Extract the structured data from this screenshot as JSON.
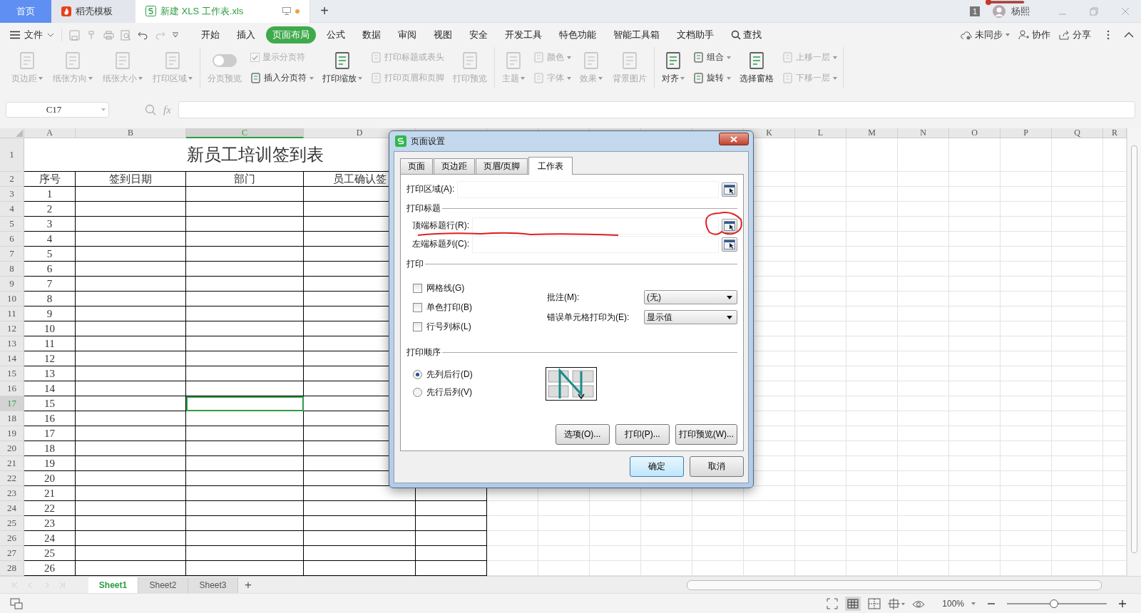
{
  "tabs": [
    {
      "label": "首页",
      "kind": "home",
      "selected": false
    },
    {
      "label": "稻壳模板",
      "kind": "docer",
      "selected": false
    },
    {
      "label": "新建 XLS 工作表.xls",
      "kind": "file",
      "selected": true
    }
  ],
  "new_tab": "+",
  "account": {
    "badge": "1",
    "name": "杨熙"
  },
  "file_menu": "文件",
  "menu": [
    {
      "label": "开始",
      "selected": false
    },
    {
      "label": "插入",
      "selected": false
    },
    {
      "label": "页面布局",
      "selected": true
    },
    {
      "label": "公式",
      "selected": false
    },
    {
      "label": "数据",
      "selected": false
    },
    {
      "label": "审阅",
      "selected": false
    },
    {
      "label": "视图",
      "selected": false
    },
    {
      "label": "安全",
      "selected": false
    },
    {
      "label": "开发工具",
      "selected": false
    },
    {
      "label": "特色功能",
      "selected": false
    },
    {
      "label": "智能工具箱",
      "selected": false
    },
    {
      "label": "文档助手",
      "selected": false
    }
  ],
  "search": "查找",
  "right_actions": [
    {
      "label": "未同步",
      "kind": "sync"
    },
    {
      "label": "协作",
      "kind": "collab"
    },
    {
      "label": "分享",
      "kind": "share"
    }
  ],
  "ribbon": [
    [
      [
        {
          "label": "页边距",
          "kind": "large",
          "disabled": true,
          "dropdown": true
        }
      ],
      [
        {
          "label": "纸张方向",
          "kind": "large",
          "disabled": true,
          "dropdown": true
        }
      ],
      [
        {
          "label": "纸张大小",
          "kind": "large",
          "disabled": true,
          "dropdown": true
        }
      ],
      [
        {
          "label": "打印区域",
          "kind": "large",
          "disabled": true,
          "dropdown": true
        }
      ]
    ],
    [
      [
        {
          "label": "分页预览",
          "kind": "toggle",
          "disabled": true,
          "dropdown": false,
          "on": false
        }
      ],
      [
        {
          "label": "显示分页符",
          "kind": "check",
          "disabled": true,
          "dropdown": false,
          "checked": true
        },
        {
          "label": "插入分页符",
          "kind": "small",
          "disabled": false,
          "dropdown": true
        }
      ],
      [
        {
          "label": "打印缩放",
          "kind": "large",
          "disabled": false,
          "dropdown": true
        }
      ],
      [
        {
          "label": "打印标题或表头",
          "kind": "small",
          "disabled": true,
          "dropdown": false
        },
        {
          "label": "打印页眉和页脚",
          "kind": "small",
          "disabled": true,
          "dropdown": false
        }
      ],
      [
        {
          "label": "打印预览",
          "kind": "large",
          "disabled": true,
          "dropdown": false
        }
      ]
    ],
    [
      [
        {
          "label": "主题",
          "kind": "large",
          "disabled": true,
          "dropdown": true
        }
      ],
      [
        {
          "label": "颜色",
          "kind": "small",
          "disabled": true,
          "dropdown": true
        },
        {
          "label": "字体",
          "kind": "small",
          "disabled": true,
          "dropdown": true
        }
      ],
      [
        {
          "label": "效果",
          "kind": "large",
          "disabled": true,
          "dropdown": true
        }
      ],
      [
        {
          "label": "背景图片",
          "kind": "large",
          "disabled": true,
          "dropdown": false
        }
      ]
    ],
    [
      [
        {
          "label": "对齐",
          "kind": "large",
          "disabled": false,
          "dropdown": true
        }
      ],
      [
        {
          "label": "组合",
          "kind": "small",
          "disabled": false,
          "dropdown": true
        },
        {
          "label": "旋转",
          "kind": "small",
          "disabled": false,
          "dropdown": true
        }
      ],
      [
        {
          "label": "选择窗格",
          "kind": "large",
          "disabled": false,
          "dropdown": false
        }
      ],
      [
        {
          "label": "上移一层",
          "kind": "small",
          "disabled": true,
          "dropdown": true
        },
        {
          "label": "下移一层",
          "kind": "small",
          "disabled": true,
          "dropdown": true
        }
      ]
    ]
  ],
  "name_box": "C17",
  "formula_label": "fx",
  "sheet": {
    "title": "新员工培训签到表",
    "headers": [
      "序号",
      "签到日期",
      "部门",
      "员工确认签"
    ],
    "columns": [
      {
        "label": "A",
        "selected": false
      },
      {
        "label": "B",
        "selected": false
      },
      {
        "label": "C",
        "selected": true
      },
      {
        "label": "D",
        "selected": false
      },
      {
        "selected": false
      },
      {
        "selected": false
      },
      {
        "selected": false
      },
      {
        "selected": false
      },
      {
        "selected": false
      },
      {
        "selected": false
      },
      {
        "label": "K",
        "selected": false
      },
      {
        "label": "L",
        "selected": false
      },
      {
        "label": "M",
        "selected": false
      },
      {
        "label": "N",
        "selected": false
      },
      {
        "label": "O",
        "selected": false
      },
      {
        "label": "P",
        "selected": false
      },
      {
        "label": "Q",
        "selected": false
      },
      {
        "label": "R",
        "selected": false
      }
    ],
    "rows": [
      {
        "label": "1",
        "kind": "title",
        "selected": false
      },
      {
        "label": "2",
        "kind": "header",
        "selected": false
      },
      {
        "label": "3",
        "kind": "data",
        "no": "1",
        "selected": false
      },
      {
        "label": "4",
        "kind": "data",
        "no": "2",
        "selected": false
      },
      {
        "label": "5",
        "kind": "data",
        "no": "3",
        "selected": false
      },
      {
        "label": "6",
        "kind": "data",
        "no": "4",
        "selected": false
      },
      {
        "label": "7",
        "kind": "data",
        "no": "5",
        "selected": false
      },
      {
        "label": "8",
        "kind": "data",
        "no": "6",
        "selected": false
      },
      {
        "label": "9",
        "kind": "data",
        "no": "7",
        "selected": false
      },
      {
        "label": "10",
        "kind": "data",
        "no": "8",
        "selected": false
      },
      {
        "label": "11",
        "kind": "data",
        "no": "9",
        "selected": false
      },
      {
        "label": "12",
        "kind": "data",
        "no": "10",
        "selected": false
      },
      {
        "label": "13",
        "kind": "data",
        "no": "11",
        "selected": false
      },
      {
        "label": "14",
        "kind": "data",
        "no": "12",
        "selected": false
      },
      {
        "label": "15",
        "kind": "data",
        "no": "13",
        "selected": false
      },
      {
        "label": "16",
        "kind": "data",
        "no": "14",
        "selected": false
      },
      {
        "label": "17",
        "kind": "data",
        "no": "15",
        "selected": true
      },
      {
        "label": "18",
        "kind": "data",
        "no": "16",
        "selected": false
      },
      {
        "label": "19",
        "kind": "data",
        "no": "17",
        "selected": false
      },
      {
        "label": "20",
        "kind": "data",
        "no": "18",
        "selected": false
      },
      {
        "label": "21",
        "kind": "data",
        "no": "19",
        "selected": false
      },
      {
        "label": "22",
        "kind": "data",
        "no": "20",
        "selected": false
      },
      {
        "label": "23",
        "kind": "data",
        "no": "21",
        "selected": false
      },
      {
        "label": "24",
        "kind": "data",
        "no": "22",
        "selected": false
      },
      {
        "label": "25",
        "kind": "data",
        "no": "23",
        "selected": false
      },
      {
        "label": "26",
        "kind": "data",
        "no": "24",
        "selected": false
      },
      {
        "label": "27",
        "kind": "data",
        "no": "25",
        "selected": false
      },
      {
        "label": "28",
        "kind": "data",
        "no": "26",
        "selected": false
      }
    ]
  },
  "dialog": {
    "title": "页面设置",
    "tabs": [
      {
        "label": "页面",
        "selected": false
      },
      {
        "label": "页边距",
        "selected": false
      },
      {
        "label": "页眉/页脚",
        "selected": false
      },
      {
        "label": "工作表",
        "selected": true
      }
    ],
    "print_area": "打印区域(A):",
    "print_titles": {
      "heading": "打印标题",
      "fields": [
        "顶端标题行(R):",
        "左端标题列(C):"
      ]
    },
    "print": {
      "heading": "打印",
      "options": [
        {
          "label": "网格线(G)",
          "checked": false
        },
        {
          "label": "单色打印(B)",
          "checked": false
        },
        {
          "label": "行号列标(L)",
          "checked": false
        }
      ],
      "selects": [
        {
          "label": "批注(M):",
          "value": "(无)"
        },
        {
          "label": "错误单元格打印为(E):",
          "value": "显示值"
        }
      ]
    },
    "order": {
      "heading": "打印顺序",
      "options": [
        {
          "label": "先列后行(D)",
          "selected": true
        },
        {
          "label": "先行后列(V)",
          "selected": false
        }
      ]
    },
    "actions": [
      "选项(O)...",
      "打印(P)...",
      "打印预览(W)..."
    ],
    "footer": [
      {
        "label": "确定",
        "default": true
      },
      {
        "label": "取消",
        "default": false
      }
    ]
  },
  "sheet_tabs": [
    {
      "label": "Sheet1",
      "selected": true
    },
    {
      "label": "Sheet2",
      "selected": false
    },
    {
      "label": "Sheet3",
      "selected": false
    }
  ],
  "add_sheet": "+",
  "zoom": {
    "reading": "100%",
    "level": 0.47
  }
}
